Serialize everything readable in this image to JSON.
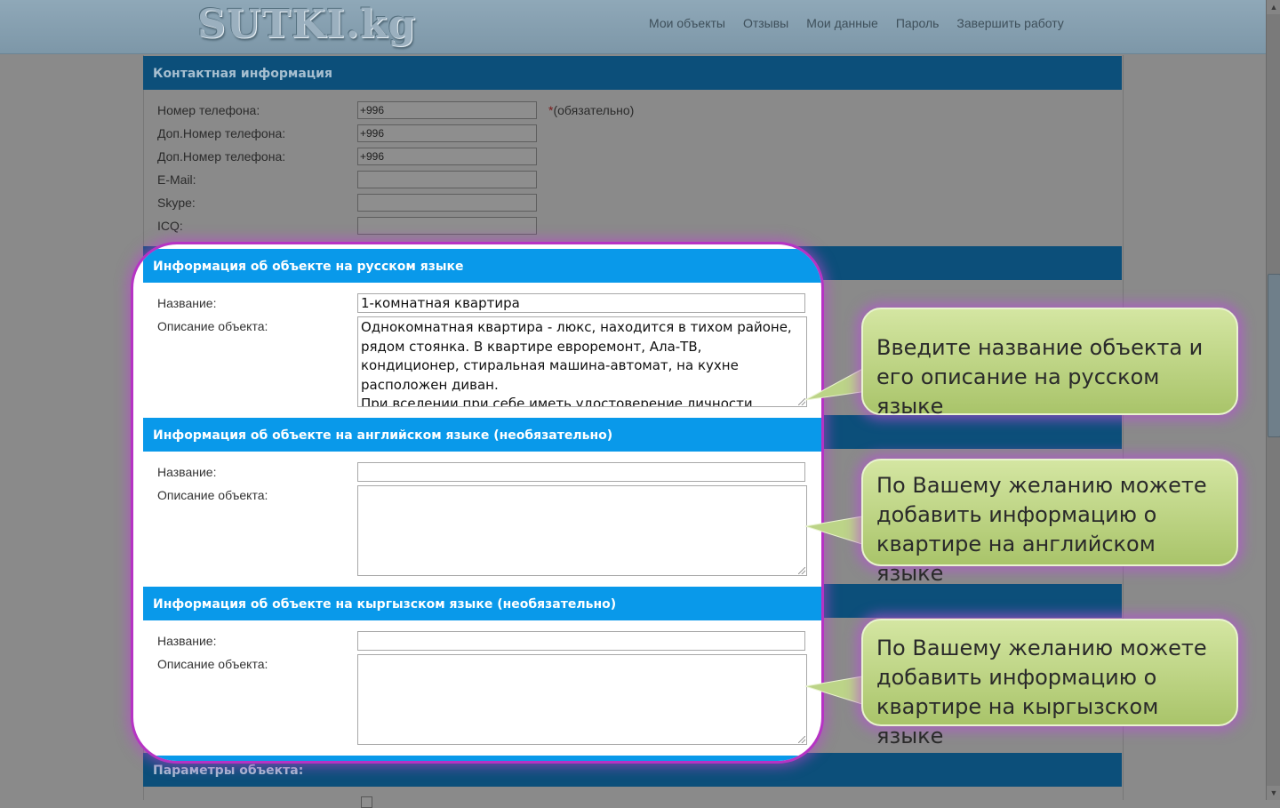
{
  "header": {
    "logo": "SUTKI.kg",
    "nav": [
      "Мои объекты",
      "Отзывы",
      "Мои данные",
      "Пароль",
      "Завершить работу"
    ]
  },
  "contact": {
    "title": "Контактная информация",
    "fields": [
      {
        "label": "Номер телефона:",
        "value": "+996"
      },
      {
        "label": "Доп.Номер телефона:",
        "value": "+996"
      },
      {
        "label": "Доп.Номер телефона:",
        "value": "+996"
      },
      {
        "label": "E-Mail:",
        "value": ""
      },
      {
        "label": "Skype:",
        "value": ""
      },
      {
        "label": "ICQ:",
        "value": ""
      }
    ],
    "required_mark": "*",
    "required_text": "(обязательно)"
  },
  "sections": [
    {
      "title": "Информация об объекте на русском языке",
      "name_label": "Название:",
      "name_value": "1-комнатная квартира",
      "desc_label": "Описание объекта:",
      "desc_value": "Однокомнатная квартира - люкс, находится в тихом районе, рядом стоянка. В квартире евроремонт, Ала-ТВ, кондиционер, стиральная машина-автомат, на кухне расположен диван.\nПри вселении при себе иметь удостоверение личности."
    },
    {
      "title": "Информация об объекте на английском языке (необязательно)",
      "name_label": "Название:",
      "name_value": "",
      "desc_label": "Описание объекта:",
      "desc_value": ""
    },
    {
      "title": "Информация об объекте на кыргызском языке (необязательно)",
      "name_label": "Название:",
      "name_value": "",
      "desc_label": "Описание объекта:",
      "desc_value": ""
    }
  ],
  "params": {
    "title": "Параметры объекта:"
  },
  "callouts": [
    "Введите название объекта и его описание на русском языке",
    "По Вашему желанию можете добавить информацию о квартире на английском языке",
    "По Вашему желанию можете добавить информацию о квартире на кыргызском языке"
  ],
  "colors": {
    "section_header": "#0999ea",
    "highlight_border": "#b633c4",
    "callout_green": "#a9c46a"
  }
}
